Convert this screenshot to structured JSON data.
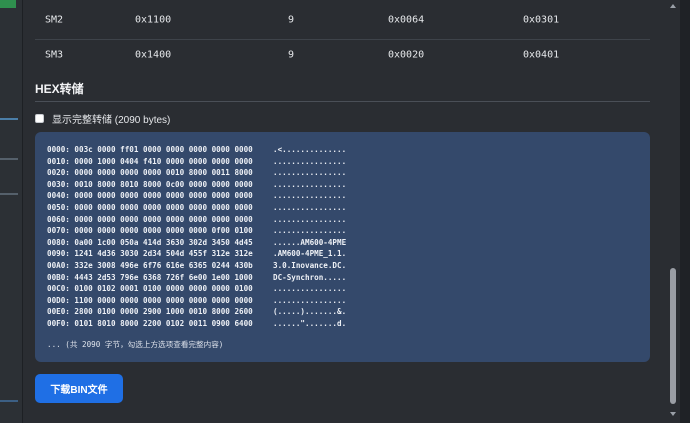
{
  "table": {
    "rows": [
      {
        "name": "SM2",
        "address": "0x1100",
        "length": "9",
        "control": "0x0064",
        "status": "0x0301"
      },
      {
        "name": "SM3",
        "address": "0x1400",
        "length": "9",
        "control": "0x0020",
        "status": "0x0401"
      }
    ]
  },
  "hex_section": {
    "title": "HEX转储",
    "toggle_label": "显示完整转储 (2090 bytes)",
    "lines": [
      {
        "bytes": "0000: 003c 0000 ff01 0000 0000 0000 0000 0000",
        "ascii": ".<.............."
      },
      {
        "bytes": "0010: 0000 1000 0404 f410 0000 0000 0000 0000",
        "ascii": "................"
      },
      {
        "bytes": "0020: 0000 0000 0000 0000 0010 8000 0011 8000",
        "ascii": "................"
      },
      {
        "bytes": "0030: 0010 8000 8010 8000 0c00 0000 0000 0000",
        "ascii": "................"
      },
      {
        "bytes": "0040: 0000 0000 0000 0000 0000 0000 0000 0000",
        "ascii": "................"
      },
      {
        "bytes": "0050: 0000 0000 0000 0000 0000 0000 0000 0000",
        "ascii": "................"
      },
      {
        "bytes": "0060: 0000 0000 0000 0000 0000 0000 0000 0000",
        "ascii": "................"
      },
      {
        "bytes": "0070: 0000 0000 0000 0000 0000 0000 0f00 0100",
        "ascii": "................"
      },
      {
        "bytes": "0080: 0a00 1c00 050a 414d 3630 302d 3450 4d45",
        "ascii": "......AM600-4PME"
      },
      {
        "bytes": "0090: 1241 4d36 3030 2d34 504d 455f 312e 312e",
        "ascii": ".AM600-4PME_1.1."
      },
      {
        "bytes": "00A0: 332e 3008 496e 6f76 616e 6365 0244 430b",
        "ascii": "3.0.Inovance.DC."
      },
      {
        "bytes": "00B0: 4443 2d53 796e 6368 726f 6e00 1e00 1000",
        "ascii": "DC-Synchron....."
      },
      {
        "bytes": "00C0: 0100 0102 0001 0100 0000 0000 0000 0100",
        "ascii": "................"
      },
      {
        "bytes": "00D0: 1100 0000 0000 0000 0000 0000 0000 0000",
        "ascii": "................"
      },
      {
        "bytes": "00E0: 2800 0100 0000 2900 1000 0010 8000 2600",
        "ascii": "(.....).......&."
      },
      {
        "bytes": "00F0: 0101 8010 8000 2200 0102 0011 0900 6400",
        "ascii": "......\".......d."
      }
    ],
    "note": "... (共 2090 字节，勾选上方选项查看完整内容)"
  },
  "download_label": "下载BIN文件",
  "colors": {
    "hex_bg": "#34496b",
    "button_bg": "#1f6fe5",
    "panel_bg": "#2a2d32"
  }
}
